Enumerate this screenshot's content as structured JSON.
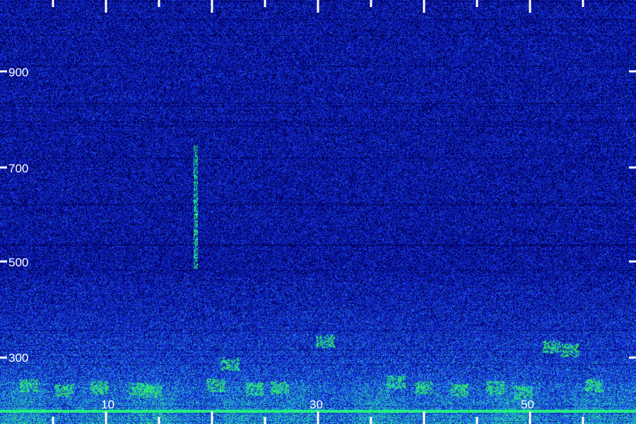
{
  "chart_data": {
    "type": "heatmap",
    "title": "",
    "xlabel": "",
    "ylabel": "",
    "x_tick_labels": [
      "10",
      "30",
      "50"
    ],
    "y_tick_labels": [
      "900",
      "700",
      "500",
      "300"
    ],
    "colors": {
      "background": "#000000",
      "low": "#0a0a5a",
      "mid": "#2a4fd6",
      "high": "#19e6a0",
      "peak": "#39ff4a",
      "axis": "#ffffff"
    },
    "features": [
      {
        "kind": "broadband-energy",
        "y_range": [
          200,
          400
        ],
        "note": "strong low band"
      },
      {
        "kind": "narrow-vertical-streak",
        "x": 19,
        "y_range": [
          520,
          780
        ]
      }
    ]
  }
}
